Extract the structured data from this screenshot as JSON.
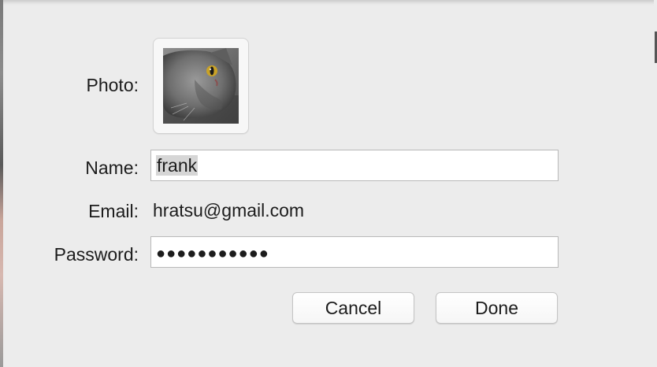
{
  "form": {
    "photo_label": "Photo:",
    "name_label": "Name:",
    "email_label": "Email:",
    "password_label": "Password:",
    "name_value": "frank",
    "email_value": "hratsu@gmail.com",
    "password_value": "●●●●●●●●●●●"
  },
  "buttons": {
    "cancel_label": "Cancel",
    "done_label": "Done"
  },
  "photo": {
    "icon": "cat-photo"
  }
}
